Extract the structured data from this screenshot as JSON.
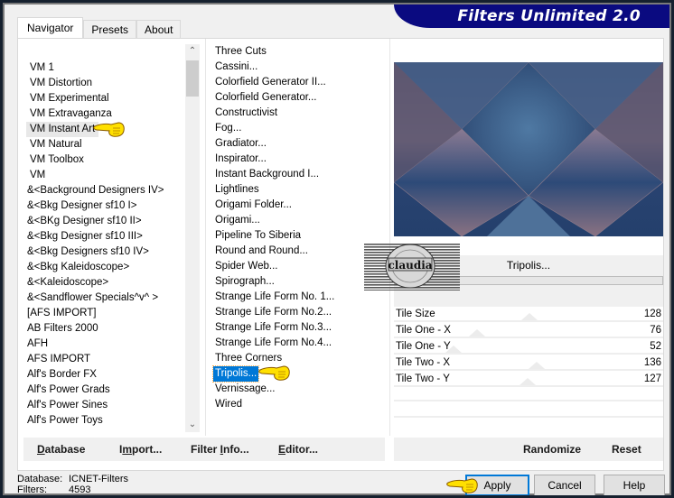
{
  "window": {
    "title": "Filters Unlimited 2.0"
  },
  "tabs": [
    {
      "label": "Navigator",
      "active": true
    },
    {
      "label": "Presets",
      "active": false
    },
    {
      "label": "About",
      "active": false
    }
  ],
  "categories": {
    "selected": "VM Instant Art",
    "items": [
      "VM 1",
      "VM Distortion",
      "VM Experimental",
      "VM Extravaganza",
      "VM Instant Art",
      "VM Natural",
      "VM Toolbox",
      "VM",
      "&<Background Designers IV>",
      "&<Bkg Designer sf10 I>",
      "&<BKg Designer sf10 II>",
      "&<Bkg Designer sf10 III>",
      "&<Bkg Designers sf10 IV>",
      "&<Bkg Kaleidoscope>",
      "&<Kaleidoscope>",
      "&<Sandflower Specials^v^ >",
      "[AFS IMPORT]",
      "AB Filters 2000",
      "AFH",
      "AFS IMPORT",
      "Alf's Border FX",
      "Alf's Power Grads",
      "Alf's Power Sines",
      "Alf's Power Toys"
    ]
  },
  "filters": {
    "selected": "Tripolis...",
    "items": [
      " Three Cuts",
      "Cassini...",
      "Colorfield Generator II...",
      "Colorfield Generator...",
      "Constructivist",
      "Fog...",
      "Gradiator...",
      "Inspirator...",
      "Instant Background I...",
      "Lightlines",
      "Origami Folder...",
      "Origami...",
      "Pipeline To Siberia",
      "Round and Round...",
      "Spider Web...",
      "Spirograph...",
      "Strange Life Form No. 1...",
      "Strange Life Form No.2...",
      "Strange Life Form No.3...",
      "Strange Life Form No.4...",
      "Three Corners",
      "Tripolis...",
      "Vernissage...",
      "Wired"
    ]
  },
  "preview": {
    "filter_name": "Tripolis...",
    "colors": {
      "dark_blue": "#24406c",
      "steel_blue": "#4a6f99",
      "mauve": "#8a7282",
      "rose": "#a88a8e"
    }
  },
  "parameters": [
    {
      "label": "Tile Size",
      "value": 128,
      "max": 255
    },
    {
      "label": "Tile One - X",
      "value": 76,
      "max": 255
    },
    {
      "label": "Tile One - Y",
      "value": 52,
      "max": 255
    },
    {
      "label": "Tile Two - X",
      "value": 136,
      "max": 255
    },
    {
      "label": "Tile Two - Y",
      "value": 127,
      "max": 255
    }
  ],
  "left_buttons": {
    "database": {
      "label_u": "D",
      "label_rest": "atabase"
    },
    "import": {
      "label_pre": "I",
      "label_u": "m",
      "label_rest": "port..."
    },
    "filter_info": {
      "label_pre": "Filter ",
      "label_u": "I",
      "label_rest": "nfo..."
    },
    "editor": {
      "label_u": "E",
      "label_rest": "ditor..."
    }
  },
  "right_buttons": {
    "randomize": "Randomize",
    "reset": "Reset"
  },
  "status": {
    "database_label": "Database:",
    "database_value": "ICNET-Filters",
    "filters_label": "Filters:",
    "filters_value": "4593"
  },
  "dialog_buttons": {
    "apply": "Apply",
    "cancel": "Cancel",
    "help": "Help"
  },
  "watermark": {
    "text": "claudia"
  },
  "icons": {
    "pointer": "pointing-hand-icon",
    "scroll_up": "chevron-up-icon",
    "scroll_down": "chevron-down-icon"
  }
}
